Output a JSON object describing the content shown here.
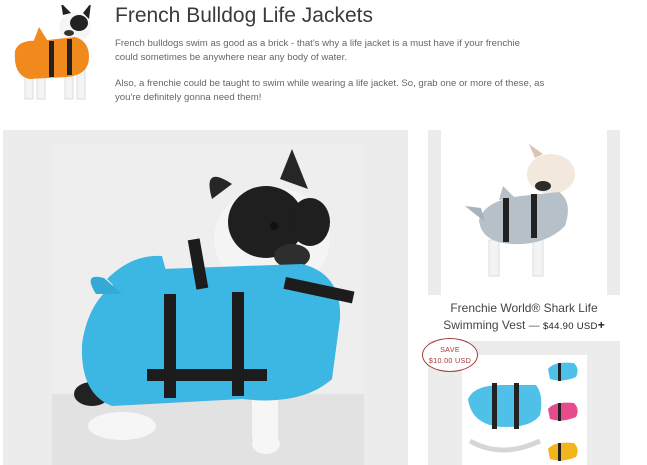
{
  "header": {
    "title": "French Bulldog Life Jackets",
    "description_1": "French bulldogs swim as good as a brick - that's why a life jacket is a must have if your frenchie could sometimes be anywhere near any body of water.",
    "description_2": "Also, a frenchie could be taught to swim while wearing a life jacket. So, grab one or more of these, as you're definitely gonna need them!"
  },
  "products": [
    {
      "name": "Frenchie World® Shark Life Swimming Vest",
      "separator": "—",
      "price": "$44.90 USD",
      "plus": "+"
    }
  ],
  "badge": {
    "line1": "SAVE",
    "line2": "$10.00 USD"
  },
  "colors": {
    "background": "#ffffff",
    "panel": "#ececec",
    "badge": "#a33a3a",
    "jacket_main": "#3cb6e3",
    "jacket_thumb": "#f08a1c"
  }
}
